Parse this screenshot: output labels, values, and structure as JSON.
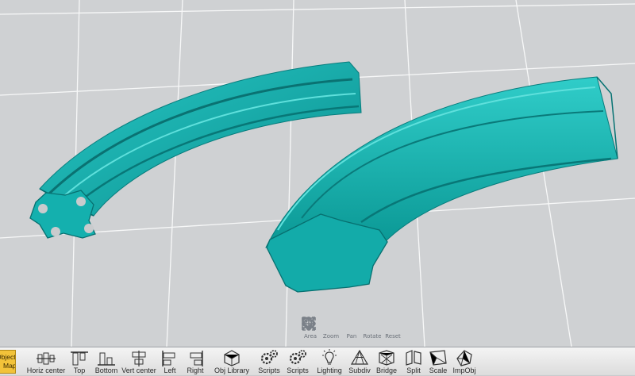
{
  "viewport_nav": [
    {
      "id": "area",
      "label": "Area",
      "icon": "area-select-icon"
    },
    {
      "id": "zoom",
      "label": "Zoom",
      "icon": "magnifier-icon"
    },
    {
      "id": "pan",
      "label": "Pan",
      "icon": "pan-arrows-icon"
    },
    {
      "id": "rotate",
      "label": "Rotate",
      "icon": "rotate-icon"
    },
    {
      "id": "reset",
      "label": "Reset",
      "icon": "reset-expand-icon"
    }
  ],
  "object_map": {
    "line1": "Object",
    "line2": "Map"
  },
  "toolbar": [
    {
      "id": "horiz-center",
      "label": "Horiz center",
      "icon": "horiz-center-icon"
    },
    {
      "id": "top",
      "label": "Top",
      "icon": "align-top-icon"
    },
    {
      "id": "bottom",
      "label": "Bottom",
      "icon": "align-bottom-icon"
    },
    {
      "id": "vert-center",
      "label": "Vert center",
      "icon": "vert-center-icon"
    },
    {
      "id": "left",
      "label": "Left",
      "icon": "align-left-icon"
    },
    {
      "id": "right",
      "label": "Right",
      "icon": "align-right-icon"
    },
    {
      "id": "obj-library",
      "label": "Obj Library",
      "icon": "obj-library-icon"
    },
    {
      "id": "scripts-1",
      "label": "Scripts",
      "icon": "gears-icon"
    },
    {
      "id": "scripts-2",
      "label": "Scripts",
      "icon": "gears-icon"
    },
    {
      "id": "lighting",
      "label": "Lighting",
      "icon": "light-bulb-icon"
    },
    {
      "id": "subdiv",
      "label": "Subdiv",
      "icon": "subdiv-icon"
    },
    {
      "id": "bridge",
      "label": "Bridge",
      "icon": "bridge-icon"
    },
    {
      "id": "split",
      "label": "Split",
      "icon": "split-icon"
    },
    {
      "id": "scale",
      "label": "Scale",
      "icon": "scale-icon"
    },
    {
      "id": "impobj",
      "label": "ImpObj",
      "icon": "import-obj-icon"
    }
  ]
}
